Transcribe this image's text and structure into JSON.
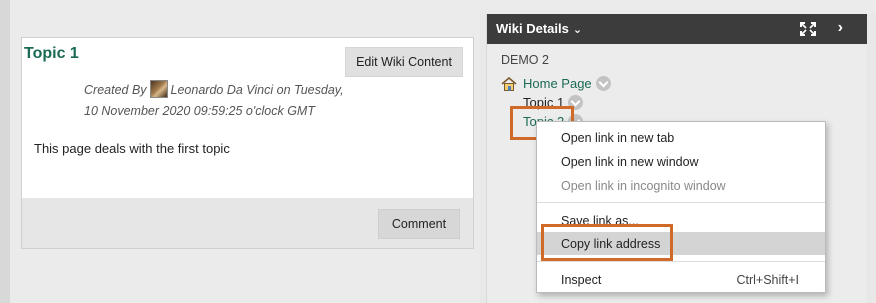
{
  "page": {
    "title": "Topic 1",
    "edit_button": "Edit Wiki Content",
    "meta_created_by": "Created By",
    "meta_author": "Leonardo Da Vinci on Tuesday,",
    "meta_date": "10 November 2020 09:59:25 o'clock GMT",
    "body": "This page deals with the first topic",
    "comment_button": "Comment"
  },
  "details": {
    "title": "Wiki Details",
    "wiki_name": "DEMO 2",
    "tree": [
      {
        "label": "Home Page"
      },
      {
        "label": "Topic 1"
      },
      {
        "label": "Topic 2"
      }
    ]
  },
  "context_menu": {
    "items": [
      {
        "label": "Open link in new tab"
      },
      {
        "label": "Open link in new window"
      },
      {
        "label": "Open link in incognito window"
      },
      {
        "label": "Save link as..."
      },
      {
        "label": "Copy link address"
      },
      {
        "label": "Inspect",
        "shortcut": "Ctrl+Shift+I"
      }
    ]
  },
  "colors": {
    "accent_link": "#1a6a55",
    "highlight": "#d06a28",
    "header_bar": "#3c3c3c"
  },
  "icons": {
    "home": "home-icon",
    "expand": "expand-icon",
    "next": "chevron-right-icon",
    "dropdown": "chevron-down-icon"
  }
}
